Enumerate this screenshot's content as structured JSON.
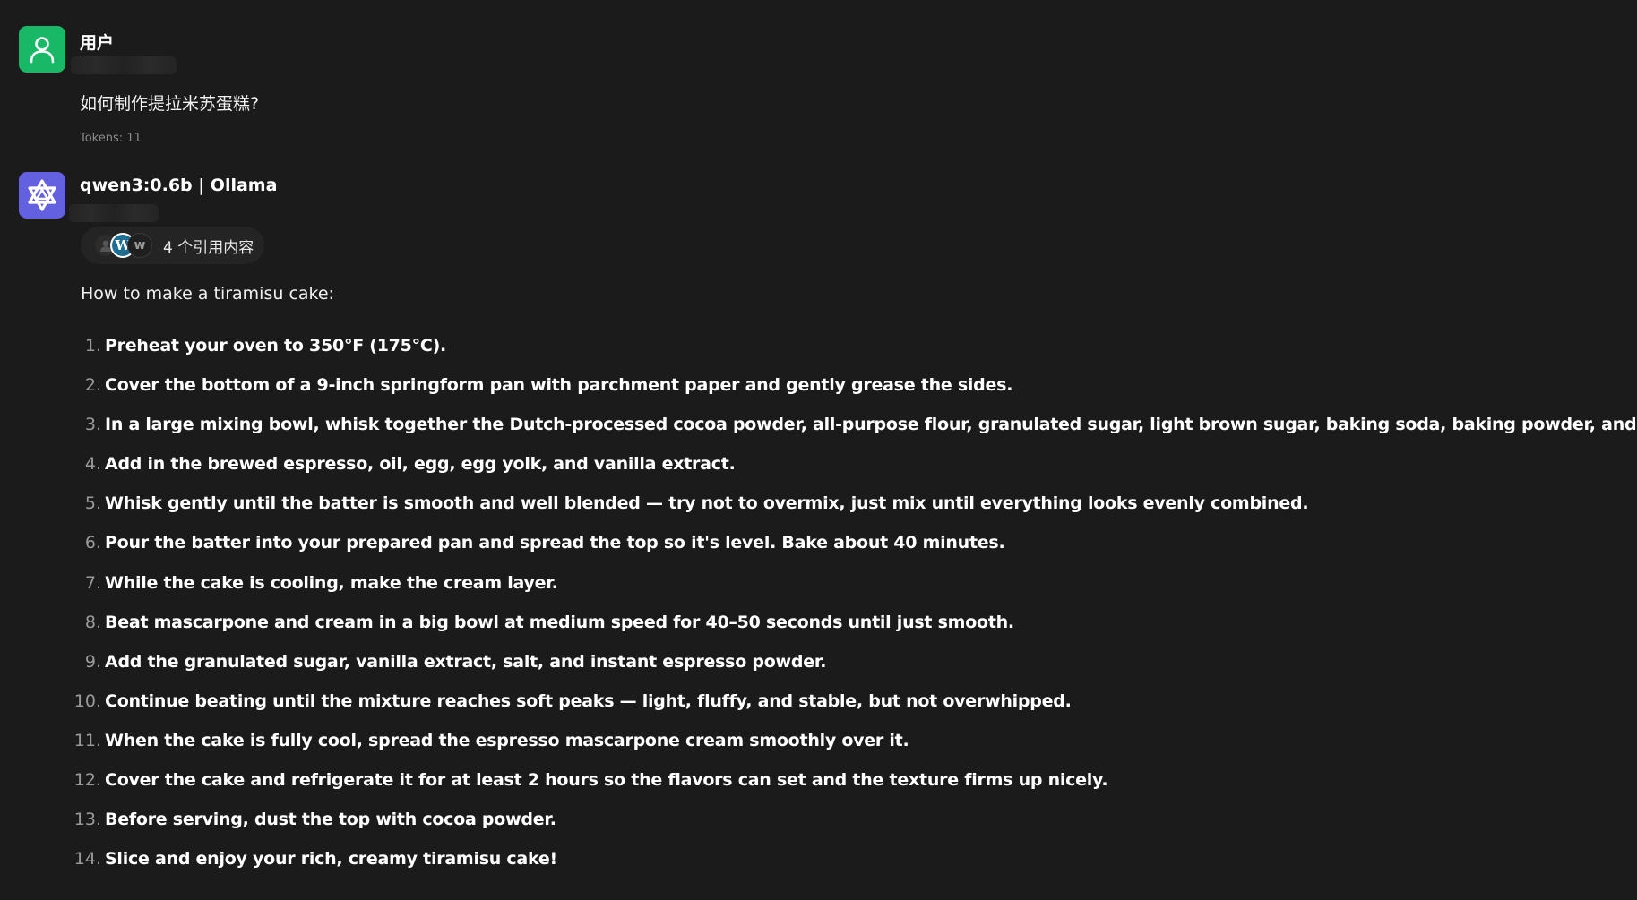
{
  "user_message": {
    "sender": "用户",
    "avatar_icon": "user-icon",
    "avatar_color": "#19b866",
    "text": "如何制作提拉米苏蛋糕?",
    "tokens": "Tokens: 11"
  },
  "assistant_message": {
    "sender": "qwen3:0.6b | Ollama",
    "avatar_icon": "qwen-logo-icon",
    "avatar_color": "#6461e0",
    "citations": {
      "label": "4 个引用内容",
      "source_icons": [
        "source-avatar-icon",
        "wordpress-icon",
        "w-letter-icon"
      ],
      "w_letter": "w",
      "wordpress_letter": "W"
    },
    "intro": "How to make a tiramisu cake:",
    "steps": [
      {
        "num": "1.",
        "text": "Preheat your oven to 350°F (175°C)."
      },
      {
        "num": "2.",
        "text": "Cover the bottom of a 9-inch springform pan with parchment paper and gently grease the sides."
      },
      {
        "num": "3.",
        "text": "In a large mixing bowl, whisk together the Dutch-processed cocoa powder, all-purpose flour, granulated sugar, light brown sugar, baking soda, baking powder, and salt."
      },
      {
        "num": "4.",
        "text": "Add in the brewed espresso, oil, egg, egg yolk, and vanilla extract."
      },
      {
        "num": "5.",
        "text": "Whisk gently until the batter is smooth and well blended — try not to overmix, just mix until everything looks evenly combined."
      },
      {
        "num": "6.",
        "text": "Pour the batter into your prepared pan and spread the top so it's level. Bake about 40 minutes."
      },
      {
        "num": "7.",
        "text": "While the cake is cooling, make the cream layer."
      },
      {
        "num": "8.",
        "text": "Beat mascarpone and cream in a big bowl at medium speed for 40–50 seconds until just smooth."
      },
      {
        "num": "9.",
        "text": "Add the granulated sugar, vanilla extract, salt, and instant espresso powder."
      },
      {
        "num": "10.",
        "text": "Continue beating until the mixture reaches soft peaks — light, fluffy, and stable, but not overwhipped."
      },
      {
        "num": "11.",
        "text": "When the cake is fully cool, spread the espresso mascarpone cream smoothly over it."
      },
      {
        "num": "12.",
        "text": "Cover the cake and refrigerate it for at least 2 hours so the flavors can set and the texture firms up nicely."
      },
      {
        "num": "13.",
        "text": "Before serving, dust the top with cocoa powder."
      },
      {
        "num": "14.",
        "text": "Slice and enjoy your rich, creamy tiramisu cake!"
      }
    ]
  }
}
